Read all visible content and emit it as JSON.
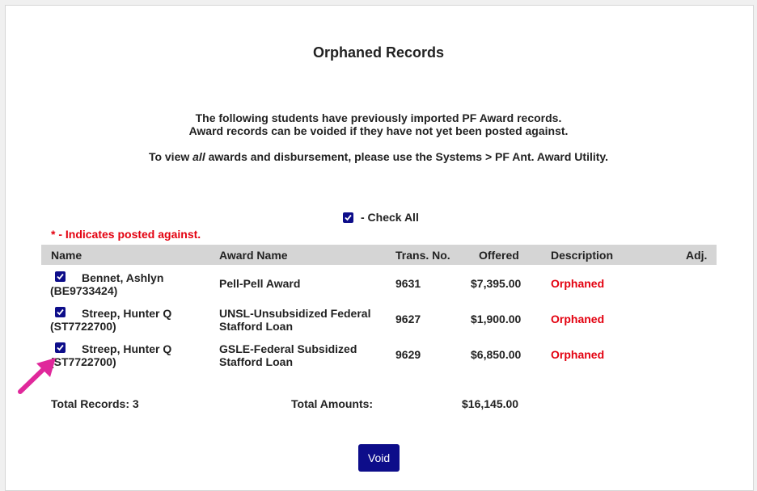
{
  "page": {
    "title": "Orphaned Records",
    "intro_line1": "The following students have previously imported PF Award records.",
    "intro_line2": "Award records can be voided if they have not yet been posted against.",
    "view_prefix": "To view ",
    "view_emph": "all",
    "view_suffix": " awards and disbursement, please use the Systems > PF Ant. Award Utility.",
    "check_all_label": "- Check All",
    "posted_note": "* - Indicates posted against."
  },
  "table": {
    "headers": {
      "name": "Name",
      "award": "Award Name",
      "trans": "Trans. No.",
      "offered": "Offered",
      "description": "Description",
      "adj": "Adj."
    },
    "rows": [
      {
        "name": "Bennet, Ashlyn",
        "id": "(BE9733424)",
        "award1": "Pell-Pell Award",
        "award2": "",
        "trans": "9631",
        "offered": "$7,395.00",
        "description": "Orphaned",
        "checked": true
      },
      {
        "name": "Streep, Hunter Q",
        "id": "(ST7722700)",
        "award1": "UNSL-Unsubsidized Federal",
        "award2": "Stafford Loan",
        "trans": "9627",
        "offered": "$1,900.00",
        "description": "Orphaned",
        "checked": true
      },
      {
        "name": "Streep, Hunter Q",
        "id": "(ST7722700)",
        "award1": "GSLE-Federal Subsidized",
        "award2": "Stafford Loan",
        "trans": "9629",
        "offered": "$6,850.00",
        "description": "Orphaned",
        "checked": true
      }
    ]
  },
  "totals": {
    "records_label": "Total Records: 3",
    "amounts_label": "Total Amounts:",
    "amount": "$16,145.00"
  },
  "actions": {
    "void_label": "Void"
  },
  "colors": {
    "accent": "#0d0d8a",
    "alert": "#e3000f",
    "header_bg": "#d5d5d5",
    "annotation_arrow": "#e0289b"
  }
}
